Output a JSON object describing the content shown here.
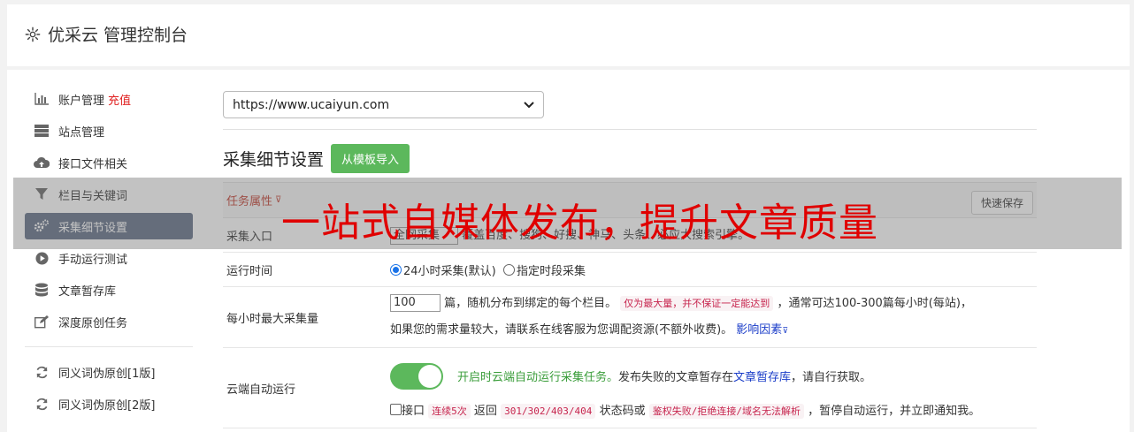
{
  "header": {
    "title": "优采云 管理控制台",
    "icon": "gear-icon"
  },
  "sidebar": {
    "items": [
      {
        "label": "账户管理",
        "badge": "充值",
        "icon": "bar-chart-icon"
      },
      {
        "label": "站点管理",
        "icon": "server-icon"
      },
      {
        "label": "接口文件相关",
        "icon": "cloud-upload-icon"
      },
      {
        "label": "栏目与关键词",
        "icon": "filter-icon"
      },
      {
        "label": "采集细节设置",
        "icon": "gears-icon",
        "active": true
      },
      {
        "label": "手动运行测试",
        "icon": "play-icon"
      },
      {
        "label": "文章暂存库",
        "icon": "database-icon"
      },
      {
        "label": "深度原创任务",
        "icon": "edit-icon"
      },
      {
        "label": "同义词伪原创[1版]",
        "icon": "refresh-icon"
      },
      {
        "label": "同义词伪原创[2版]",
        "icon": "refresh-icon"
      }
    ]
  },
  "site_select": {
    "value": "https://www.ucaiyun.com"
  },
  "section": {
    "title": "采集细节设置",
    "import_button": "从模板导入"
  },
  "task": {
    "head_label": "任务属性",
    "quick_save": "快速保存"
  },
  "rows": {
    "entry": {
      "label": "采集入口",
      "value": "全网采集",
      "desc": "覆盖百度、搜狗、好搜、神马、头条、必应大搜索引擎。"
    },
    "time": {
      "label": "运行时间",
      "opt1": "24小时采集(默认)",
      "opt2": "指定时段采集"
    },
    "max": {
      "label": "每小时最大采集量",
      "input": "100",
      "text1": "篇，随机分布到绑定的每个栏目。",
      "tag1": "仅为最大量，并不保证一定能达到",
      "text2": "，通常可达100-300篇每小时(每站)，",
      "text3": "如果您的需求量较大，请联系在线客服为您调配资源(不额外收费)。",
      "link": "影响因素"
    },
    "cloud": {
      "label": "云端自动运行",
      "green": "开启时云端自动运行采集任务。",
      "text1": "发布失败的文章暂存在",
      "link": "文章暂存库",
      "text2": "，请自行获取。",
      "cb_label": "接口",
      "tag_a": "连续5次",
      "text3": "返回",
      "tag_b": "301/302/403/404",
      "text4": "状态码或",
      "tag_c": "鉴权失败/拒绝连接/域名无法解析",
      "text5": "，暂停自动运行，并立即通知我。"
    }
  },
  "overlay": {
    "text": "一站式自媒体发布，提升文章质量"
  }
}
